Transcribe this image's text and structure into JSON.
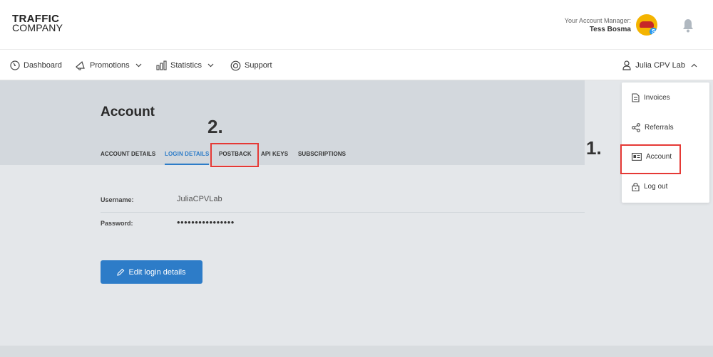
{
  "header": {
    "logo_line1": "TRAFFIC",
    "logo_line2": "COMPANY",
    "manager_label": "Your Account Manager:",
    "manager_name": "Tess Bosma"
  },
  "nav": {
    "items": [
      {
        "label": "Dashboard",
        "icon": "dashboard-gauge-icon"
      },
      {
        "label": "Promotions",
        "icon": "megaphone-icon"
      },
      {
        "label": "Statistics",
        "icon": "bar-chart-icon"
      },
      {
        "label": "Support",
        "icon": "lifebuoy-icon"
      }
    ],
    "user_label": "Julia CPV Lab"
  },
  "page": {
    "title": "Account",
    "tabs": [
      "ACCOUNT DETAILS",
      "LOGIN DETAILS",
      "POSTBACK",
      "API KEYS",
      "SUBSCRIPTIONS"
    ],
    "active_tab": "LOGIN DETAILS",
    "fields": [
      {
        "label": "Username:",
        "value": "JuliaCPVLab"
      },
      {
        "label": "Password:",
        "value": "••••••••••••••••"
      }
    ],
    "edit_button": "Edit login details"
  },
  "dropdown": {
    "items": [
      {
        "label": "Invoices",
        "icon": "document-icon"
      },
      {
        "label": "Referrals",
        "icon": "share-icon"
      },
      {
        "label": "Account",
        "icon": "id-card-icon"
      },
      {
        "label": "Log out",
        "icon": "lock-icon"
      }
    ]
  },
  "annotations": {
    "step1": "1.",
    "step2": "2."
  },
  "colors": {
    "accent": "#2d7cc8",
    "highlight": "#e53935",
    "content_bg": "#e4e7ea",
    "band_bg": "#d3d8dd"
  }
}
